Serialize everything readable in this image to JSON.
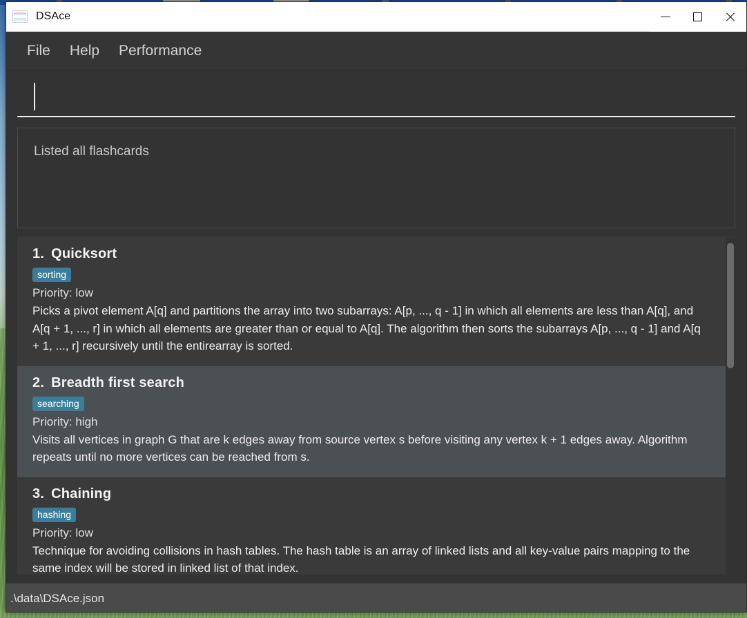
{
  "window": {
    "title": "DSAce",
    "icon": "flashcard-stack-icon",
    "controls": {
      "minimize": "minimize-icon",
      "maximize": "maximize-icon",
      "close": "close-icon"
    }
  },
  "menu": {
    "items": [
      {
        "label": "File"
      },
      {
        "label": "Help"
      },
      {
        "label": "Performance"
      }
    ]
  },
  "command_input": {
    "value": "",
    "placeholder": ""
  },
  "status_panel": {
    "message": "Listed all flashcards"
  },
  "list": {
    "cards": [
      {
        "index": "1.",
        "title": "Quicksort",
        "tag": "sorting",
        "priority": "Priority: low",
        "description": "Picks a pivot element A[q] and partitions the array into two subarrays: A[p, ..., q - 1] in which all elements are less than A[q], and A[q + 1, ..., r] in which all elements are greater than or equal to A[q]. The algorithm then sorts the subarrays A[p, ..., q - 1] and A[q + 1, ..., r] recursively until the entirearray is sorted.",
        "highlighted": false
      },
      {
        "index": "2.",
        "title": "Breadth first search",
        "tag": "searching",
        "priority": "Priority: high",
        "description": "Visits all vertices in graph G that are k edges away from source vertex s before visiting any vertex k + 1 edges away. Algorithm repeats until no more vertices can be reached from s.",
        "highlighted": true
      },
      {
        "index": "3.",
        "title": "Chaining",
        "tag": "hashing",
        "priority": "Priority: low",
        "description": "Technique for avoiding collisions in hash tables. The hash table is an array of linked lists and all key-value pairs mapping to the same index will be stored in linked list  of that index.",
        "highlighted": false
      }
    ]
  },
  "status_bar": {
    "path": ".\\data\\DSAce.json"
  },
  "colors": {
    "window_background": "#333333",
    "title_bar": "#ffffff",
    "menu_bar": "#353535",
    "card_background": "#3a3a3a",
    "card_highlight": "#4b5052",
    "tag_accent": "#3b7e9b",
    "status_bar": "#4a4a4a",
    "text_primary": "#ededed",
    "scrollbar_thumb": "#6b6b6b"
  }
}
